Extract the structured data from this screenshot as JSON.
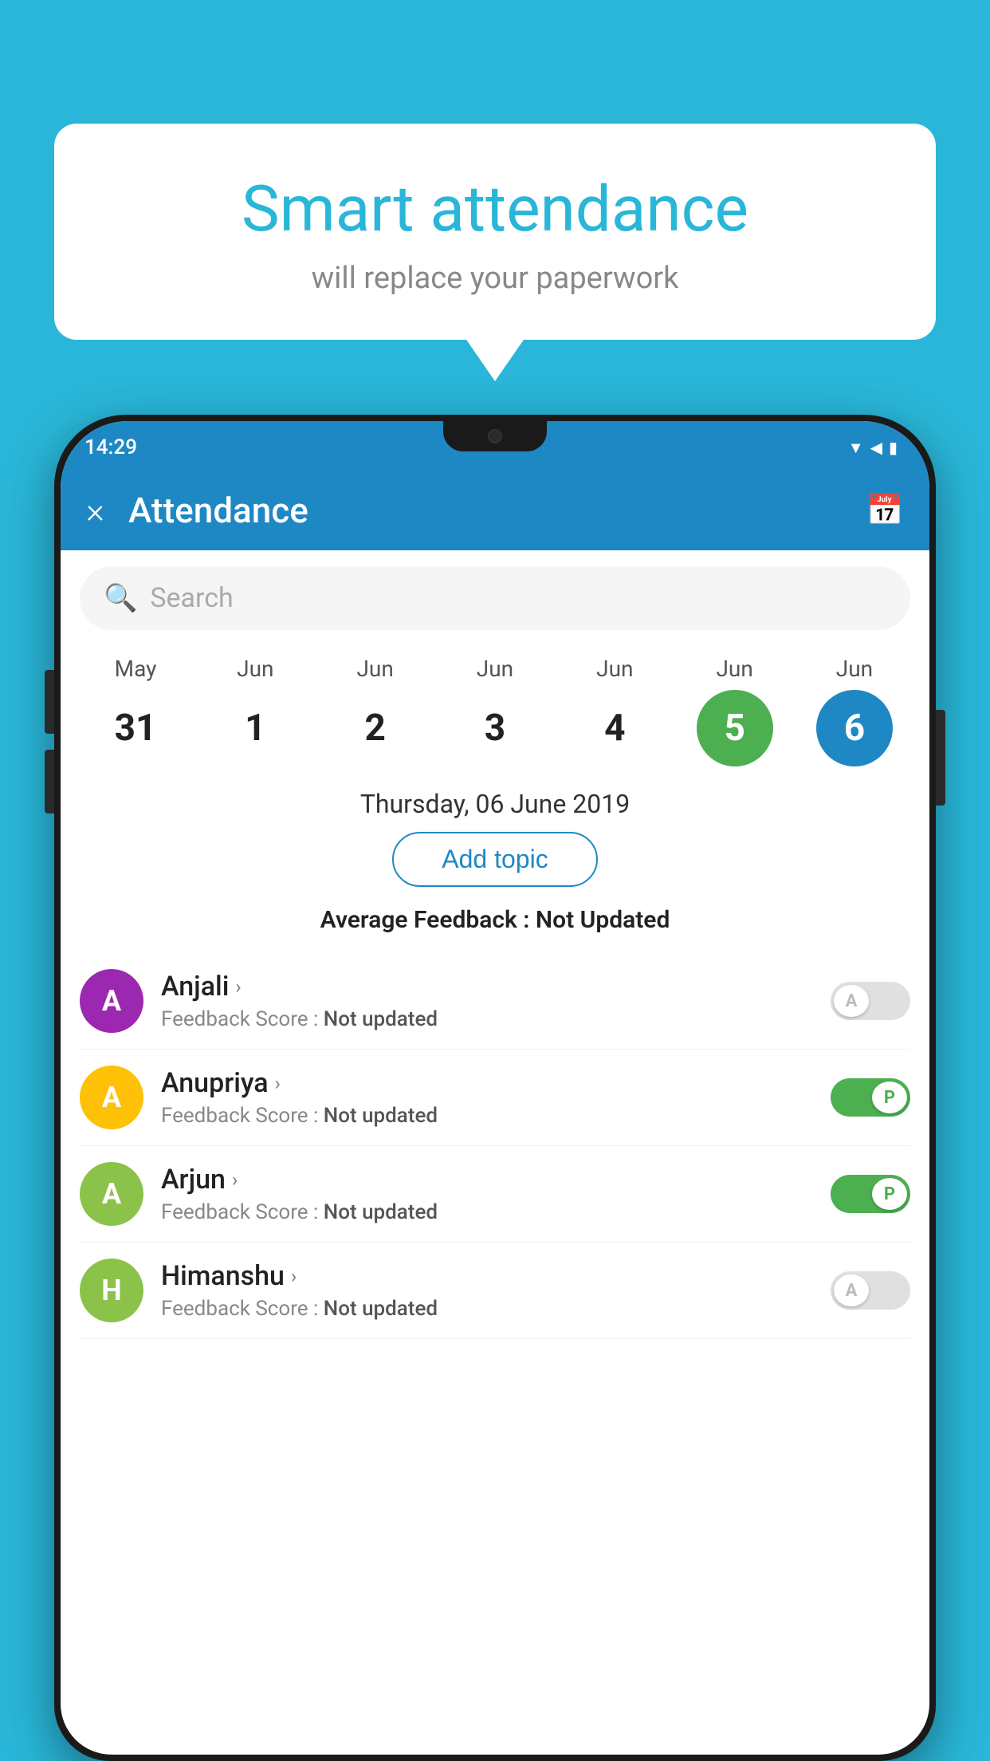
{
  "background_color": "#29B6D8",
  "bubble": {
    "title": "Smart attendance",
    "subtitle": "will replace your paperwork"
  },
  "status_bar": {
    "time": "14:29",
    "icons": [
      "▼",
      "◀",
      "▮"
    ]
  },
  "app_bar": {
    "title": "Attendance",
    "close_label": "×",
    "calendar_icon": "🗓"
  },
  "search": {
    "placeholder": "Search"
  },
  "calendar": {
    "days": [
      {
        "month": "May",
        "date": "31",
        "style": "normal"
      },
      {
        "month": "Jun",
        "date": "1",
        "style": "normal"
      },
      {
        "month": "Jun",
        "date": "2",
        "style": "normal"
      },
      {
        "month": "Jun",
        "date": "3",
        "style": "normal"
      },
      {
        "month": "Jun",
        "date": "4",
        "style": "normal"
      },
      {
        "month": "Jun",
        "date": "5",
        "style": "green"
      },
      {
        "month": "Jun",
        "date": "6",
        "style": "blue"
      }
    ]
  },
  "selected_date": "Thursday, 06 June 2019",
  "add_topic_label": "Add topic",
  "average_feedback_label": "Average Feedback :",
  "average_feedback_value": "Not Updated",
  "students": [
    {
      "name": "Anjali",
      "initial": "A",
      "avatar_color": "#9C27B0",
      "feedback_label": "Feedback Score :",
      "feedback_value": "Not updated",
      "attendance": "absent",
      "toggle_letter": "A"
    },
    {
      "name": "Anupriya",
      "initial": "A",
      "avatar_color": "#FFC107",
      "feedback_label": "Feedback Score :",
      "feedback_value": "Not updated",
      "attendance": "present",
      "toggle_letter": "P"
    },
    {
      "name": "Arjun",
      "initial": "A",
      "avatar_color": "#8BC34A",
      "feedback_label": "Feedback Score :",
      "feedback_value": "Not updated",
      "attendance": "present",
      "toggle_letter": "P"
    },
    {
      "name": "Himanshu",
      "initial": "H",
      "avatar_color": "#8BC34A",
      "feedback_label": "Feedback Score :",
      "feedback_value": "Not updated",
      "attendance": "absent",
      "toggle_letter": "A"
    }
  ]
}
